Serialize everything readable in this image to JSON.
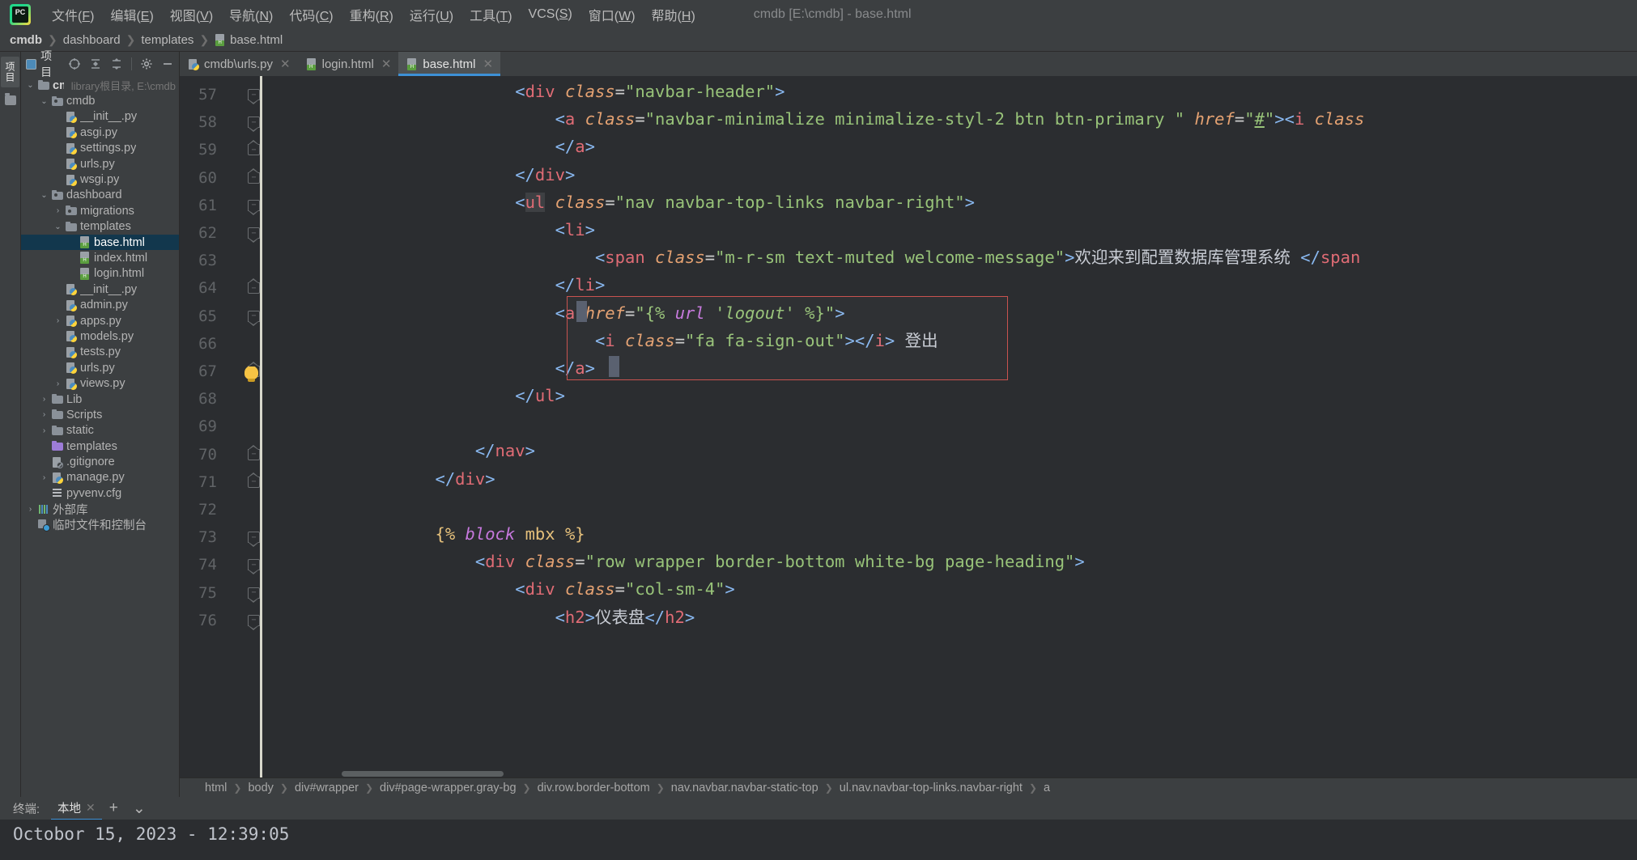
{
  "window": {
    "title": "cmdb [E:\\cmdb] - base.html",
    "app_icon": "pycharm-logo-icon"
  },
  "menubar": {
    "items": [
      {
        "label": "文件",
        "mnemonic": "F"
      },
      {
        "label": "编辑",
        "mnemonic": "E"
      },
      {
        "label": "视图",
        "mnemonic": "V"
      },
      {
        "label": "导航",
        "mnemonic": "N"
      },
      {
        "label": "代码",
        "mnemonic": "C"
      },
      {
        "label": "重构",
        "mnemonic": "R"
      },
      {
        "label": "运行",
        "mnemonic": "U"
      },
      {
        "label": "工具",
        "mnemonic": "T"
      },
      {
        "label": "VCS",
        "mnemonic": "S"
      },
      {
        "label": "窗口",
        "mnemonic": "W"
      },
      {
        "label": "帮助",
        "mnemonic": "H"
      }
    ]
  },
  "breadcrumb": {
    "items": [
      "cmdb",
      "dashboard",
      "templates",
      "base.html"
    ]
  },
  "toolstrip": {
    "project_tab": "项目",
    "structure_icon": "folder-icon"
  },
  "project_panel": {
    "title": "项目",
    "toolbar_icons": [
      "target-icon",
      "expand-all-icon",
      "collapse-all-icon",
      "gear-icon",
      "minimize-icon"
    ],
    "tree": [
      {
        "label": "cmdb",
        "hint": "library根目录, E:\\cmdb",
        "indent": 0,
        "arrow": "down",
        "icon": "folder",
        "bold": true
      },
      {
        "label": "cmdb",
        "indent": 1,
        "arrow": "down",
        "icon": "folder-module"
      },
      {
        "label": "__init__.py",
        "indent": 2,
        "arrow": "",
        "icon": "python"
      },
      {
        "label": "asgi.py",
        "indent": 2,
        "arrow": "",
        "icon": "python"
      },
      {
        "label": "settings.py",
        "indent": 2,
        "arrow": "",
        "icon": "python"
      },
      {
        "label": "urls.py",
        "indent": 2,
        "arrow": "",
        "icon": "python"
      },
      {
        "label": "wsgi.py",
        "indent": 2,
        "arrow": "",
        "icon": "python"
      },
      {
        "label": "dashboard",
        "indent": 1,
        "arrow": "down",
        "icon": "folder-module"
      },
      {
        "label": "migrations",
        "indent": 2,
        "arrow": "right",
        "icon": "folder-module"
      },
      {
        "label": "templates",
        "indent": 2,
        "arrow": "down",
        "icon": "folder"
      },
      {
        "label": "base.html",
        "indent": 3,
        "arrow": "",
        "icon": "html",
        "selected": true
      },
      {
        "label": "index.html",
        "indent": 3,
        "arrow": "",
        "icon": "html"
      },
      {
        "label": "login.html",
        "indent": 3,
        "arrow": "",
        "icon": "html"
      },
      {
        "label": "__init__.py",
        "indent": 2,
        "arrow": "",
        "icon": "python"
      },
      {
        "label": "admin.py",
        "indent": 2,
        "arrow": "",
        "icon": "python"
      },
      {
        "label": "apps.py",
        "indent": 2,
        "arrow": "right",
        "icon": "python"
      },
      {
        "label": "models.py",
        "indent": 2,
        "arrow": "",
        "icon": "python"
      },
      {
        "label": "tests.py",
        "indent": 2,
        "arrow": "",
        "icon": "python"
      },
      {
        "label": "urls.py",
        "indent": 2,
        "arrow": "",
        "icon": "python"
      },
      {
        "label": "views.py",
        "indent": 2,
        "arrow": "right",
        "icon": "python"
      },
      {
        "label": "Lib",
        "indent": 1,
        "arrow": "right",
        "icon": "folder"
      },
      {
        "label": "Scripts",
        "indent": 1,
        "arrow": "right",
        "icon": "folder"
      },
      {
        "label": "static",
        "indent": 1,
        "arrow": "right",
        "icon": "folder"
      },
      {
        "label": "templates",
        "indent": 1,
        "arrow": "",
        "icon": "folder-purple"
      },
      {
        "label": ".gitignore",
        "indent": 1,
        "arrow": "",
        "icon": "gitignore"
      },
      {
        "label": "manage.py",
        "indent": 1,
        "arrow": "right",
        "icon": "python"
      },
      {
        "label": "pyvenv.cfg",
        "indent": 1,
        "arrow": "",
        "icon": "cfg"
      },
      {
        "label": "外部库",
        "indent": 0,
        "arrow": "right",
        "icon": "libraries"
      },
      {
        "label": "临时文件和控制台",
        "indent": 0,
        "arrow": "",
        "icon": "scratches"
      }
    ]
  },
  "editor": {
    "tabs": [
      {
        "label": "cmdb\\urls.py",
        "icon": "python",
        "active": false,
        "closable": true
      },
      {
        "label": "login.html",
        "icon": "html",
        "active": false,
        "closable": true
      },
      {
        "label": "base.html",
        "icon": "html",
        "active": true,
        "closable": true
      }
    ],
    "line_numbers": [
      57,
      58,
      59,
      60,
      61,
      62,
      63,
      64,
      65,
      66,
      67,
      68,
      69,
      70,
      71,
      72,
      73,
      74,
      75,
      76
    ],
    "lines": [
      {
        "n": 57,
        "indent": 6,
        "tokens": [
          {
            "t": "brk",
            "v": "<"
          },
          {
            "t": "tag",
            "v": "div"
          },
          {
            "t": "sp",
            "v": " "
          },
          {
            "t": "attr",
            "v": "class"
          },
          {
            "t": "eq",
            "v": "="
          },
          {
            "t": "str",
            "v": "\"navbar-header\""
          },
          {
            "t": "brk",
            "v": ">"
          }
        ]
      },
      {
        "n": 58,
        "indent": 7,
        "tokens": [
          {
            "t": "brk",
            "v": "<"
          },
          {
            "t": "tag",
            "v": "a"
          },
          {
            "t": "sp",
            "v": " "
          },
          {
            "t": "attr",
            "v": "class"
          },
          {
            "t": "eq",
            "v": "="
          },
          {
            "t": "str",
            "v": "\"navbar-minimalize minimalize-styl-2 btn btn-primary \""
          },
          {
            "t": "sp",
            "v": " "
          },
          {
            "t": "attr",
            "v": "href"
          },
          {
            "t": "eq",
            "v": "="
          },
          {
            "t": "str",
            "v": "\""
          },
          {
            "t": "link",
            "v": "#"
          },
          {
            "t": "str",
            "v": "\""
          },
          {
            "t": "brk",
            "v": ">"
          },
          {
            "t": "brk",
            "v": "<"
          },
          {
            "t": "tag",
            "v": "i"
          },
          {
            "t": "sp",
            "v": " "
          },
          {
            "t": "attr",
            "v": "class"
          }
        ]
      },
      {
        "n": 59,
        "indent": 7,
        "tokens": [
          {
            "t": "brk",
            "v": "</"
          },
          {
            "t": "tag",
            "v": "a"
          },
          {
            "t": "brk",
            "v": ">"
          }
        ]
      },
      {
        "n": 60,
        "indent": 6,
        "tokens": [
          {
            "t": "brk",
            "v": "</"
          },
          {
            "t": "tag",
            "v": "div"
          },
          {
            "t": "brk",
            "v": ">"
          }
        ]
      },
      {
        "n": 61,
        "indent": 6,
        "tokens": [
          {
            "t": "brk",
            "v": "<"
          },
          {
            "t": "tagh",
            "v": "ul"
          },
          {
            "t": "sp",
            "v": " "
          },
          {
            "t": "attr",
            "v": "class"
          },
          {
            "t": "eq",
            "v": "="
          },
          {
            "t": "str",
            "v": "\"nav navbar-top-links navbar-right\""
          },
          {
            "t": "brk",
            "v": ">"
          }
        ]
      },
      {
        "n": 62,
        "indent": 7,
        "tokens": [
          {
            "t": "brk",
            "v": "<"
          },
          {
            "t": "tag",
            "v": "li"
          },
          {
            "t": "brk",
            "v": ">"
          }
        ]
      },
      {
        "n": 63,
        "indent": 8,
        "tokens": [
          {
            "t": "brk",
            "v": "<"
          },
          {
            "t": "tag",
            "v": "span"
          },
          {
            "t": "sp",
            "v": " "
          },
          {
            "t": "attr",
            "v": "class"
          },
          {
            "t": "eq",
            "v": "="
          },
          {
            "t": "str",
            "v": "\"m-r-sm text-muted welcome-message\""
          },
          {
            "t": "brk",
            "v": ">"
          },
          {
            "t": "txt",
            "v": "欢迎来到配置数据库管理系统 "
          },
          {
            "t": "brk",
            "v": "</"
          },
          {
            "t": "tag",
            "v": "span"
          }
        ]
      },
      {
        "n": 64,
        "indent": 7,
        "tokens": [
          {
            "t": "brk",
            "v": "</"
          },
          {
            "t": "tag",
            "v": "li"
          },
          {
            "t": "brk",
            "v": ">"
          }
        ]
      },
      {
        "n": 65,
        "indent": 7,
        "tokens": [
          {
            "t": "brk",
            "v": "<"
          },
          {
            "t": "tag",
            "v": "a"
          },
          {
            "t": "sp",
            "v": " "
          },
          {
            "t": "attr",
            "v": "href"
          },
          {
            "t": "eq",
            "v": "="
          },
          {
            "t": "str",
            "v": "\"{% "
          },
          {
            "t": "dj",
            "v": "url"
          },
          {
            "t": "djs",
            "v": " 'logout' "
          },
          {
            "t": "str",
            "v": "%}\""
          },
          {
            "t": "brk",
            "v": ">"
          }
        ]
      },
      {
        "n": 66,
        "indent": 8,
        "tokens": [
          {
            "t": "brk",
            "v": "<"
          },
          {
            "t": "tag",
            "v": "i"
          },
          {
            "t": "sp",
            "v": " "
          },
          {
            "t": "attr",
            "v": "class"
          },
          {
            "t": "eq",
            "v": "="
          },
          {
            "t": "str",
            "v": "\"fa fa-sign-out\""
          },
          {
            "t": "brk",
            "v": ">"
          },
          {
            "t": "brk",
            "v": "</"
          },
          {
            "t": "tag",
            "v": "i"
          },
          {
            "t": "brk",
            "v": ">"
          },
          {
            "t": "txt",
            "v": " 登出"
          }
        ]
      },
      {
        "n": 67,
        "indent": 7,
        "tokens": [
          {
            "t": "brk",
            "v": "</"
          },
          {
            "t": "tag",
            "v": "a"
          },
          {
            "t": "brk",
            "v": ">"
          }
        ]
      },
      {
        "n": 68,
        "indent": 6,
        "tokens": [
          {
            "t": "brk",
            "v": "</"
          },
          {
            "t": "tag",
            "v": "ul"
          },
          {
            "t": "brk",
            "v": ">"
          }
        ]
      },
      {
        "n": 69,
        "indent": 0,
        "tokens": []
      },
      {
        "n": 70,
        "indent": 5,
        "tokens": [
          {
            "t": "brk",
            "v": "</"
          },
          {
            "t": "tag",
            "v": "nav"
          },
          {
            "t": "brk",
            "v": ">"
          }
        ]
      },
      {
        "n": 71,
        "indent": 4,
        "tokens": [
          {
            "t": "brk",
            "v": "</"
          },
          {
            "t": "tag",
            "v": "div"
          },
          {
            "t": "brk",
            "v": ">"
          }
        ]
      },
      {
        "n": 72,
        "indent": 0,
        "tokens": []
      },
      {
        "n": 73,
        "indent": 4,
        "tokens": [
          {
            "t": "djb",
            "v": "{% "
          },
          {
            "t": "dj",
            "v": "block"
          },
          {
            "t": "djb",
            "v": " mbx %}"
          }
        ]
      },
      {
        "n": 74,
        "indent": 5,
        "tokens": [
          {
            "t": "brk",
            "v": "<"
          },
          {
            "t": "tag",
            "v": "div"
          },
          {
            "t": "sp",
            "v": " "
          },
          {
            "t": "attr",
            "v": "class"
          },
          {
            "t": "eq",
            "v": "="
          },
          {
            "t": "str",
            "v": "\"row wrapper border-bottom white-bg page-heading\""
          },
          {
            "t": "brk",
            "v": ">"
          }
        ]
      },
      {
        "n": 75,
        "indent": 6,
        "tokens": [
          {
            "t": "brk",
            "v": "<"
          },
          {
            "t": "tag",
            "v": "div"
          },
          {
            "t": "sp",
            "v": " "
          },
          {
            "t": "attr",
            "v": "class"
          },
          {
            "t": "eq",
            "v": "="
          },
          {
            "t": "str",
            "v": "\"col-sm-4\""
          },
          {
            "t": "brk",
            "v": ">"
          }
        ]
      },
      {
        "n": 76,
        "indent": 7,
        "tokens": [
          {
            "t": "brk",
            "v": "<"
          },
          {
            "t": "tag",
            "v": "h2"
          },
          {
            "t": "brk",
            "v": ">"
          },
          {
            "t": "txt",
            "v": "仪表盘"
          },
          {
            "t": "brk",
            "v": "</"
          },
          {
            "t": "tag",
            "v": "h2"
          },
          {
            "t": "brk",
            "v": ">"
          }
        ]
      }
    ],
    "element_breadcrumb": [
      "html",
      "body",
      "div#wrapper",
      "div#page-wrapper.gray-bg",
      "div.row.border-bottom",
      "nav.navbar.navbar-static-top",
      "ul.nav.navbar-top-links.navbar-right",
      "a"
    ]
  },
  "terminal": {
    "label": "终端:",
    "tab": "本地",
    "add_label": "+",
    "chevron_label": "⌄",
    "output": "Octobor 15, 2023 - 12:39:05"
  },
  "colors": {
    "accent": "#3d90d6",
    "selection": "#12374d",
    "tag": "#e06c75",
    "string": "#98c379",
    "attr": "#e5a272",
    "bg_editor": "#2b2d30",
    "bg_chrome": "#3c3f41",
    "error_border": "#c9534f"
  }
}
